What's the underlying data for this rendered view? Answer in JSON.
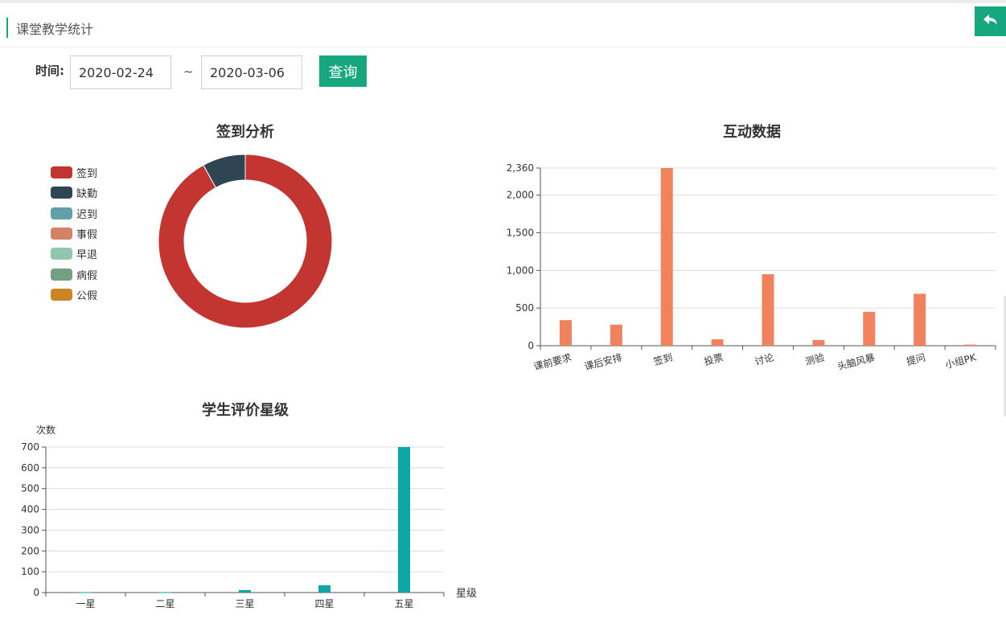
{
  "header": {
    "title": "课堂教学统计",
    "back_icon": "undo-arrow-icon"
  },
  "filter": {
    "label": "时间:",
    "start_date": "2020-02-24",
    "separator": "~",
    "end_date": "2020-03-06",
    "query_label": "查询"
  },
  "colors": {
    "accent": "#16a77f",
    "bar_orange": "#f0825d",
    "bar_teal": "#0ea6a6"
  },
  "chart_data": [
    {
      "type": "pie",
      "title": "签到分析",
      "donut": true,
      "legend_position": "left",
      "categories": [
        "签到",
        "缺勤",
        "迟到",
        "事假",
        "早退",
        "病假",
        "公假"
      ],
      "values": [
        92,
        8,
        0,
        0,
        0,
        0,
        0
      ],
      "colors": [
        "#c23531",
        "#2f4554",
        "#61a0a8",
        "#d48265",
        "#91c7ae",
        "#749f83",
        "#ca8622"
      ]
    },
    {
      "type": "bar",
      "title": "互动数据",
      "categories": [
        "课前要求",
        "课后安排",
        "签到",
        "投票",
        "讨论",
        "测验",
        "头脑风暴",
        "提问",
        "小组PK"
      ],
      "values": [
        340,
        280,
        2360,
        85,
        950,
        75,
        450,
        690,
        15
      ],
      "ylim": [
        0,
        2360
      ],
      "yticks": [
        "0",
        "500",
        "1,000",
        "1,500",
        "2,000",
        "2,360"
      ],
      "ytick_values": [
        0,
        500,
        1000,
        1500,
        2000,
        2360
      ],
      "grid": true
    },
    {
      "type": "bar",
      "title": "学生评价星级",
      "categories": [
        "一星",
        "二星",
        "三星",
        "四星",
        "五星"
      ],
      "values": [
        2,
        2,
        12,
        35,
        700
      ],
      "ylabel": "次数",
      "xlabel": "星级",
      "ylim": [
        0,
        700
      ],
      "yticks": [
        "0",
        "100",
        "200",
        "300",
        "400",
        "500",
        "600",
        "700"
      ],
      "ytick_values": [
        0,
        100,
        200,
        300,
        400,
        500,
        600,
        700
      ],
      "grid": true
    }
  ]
}
